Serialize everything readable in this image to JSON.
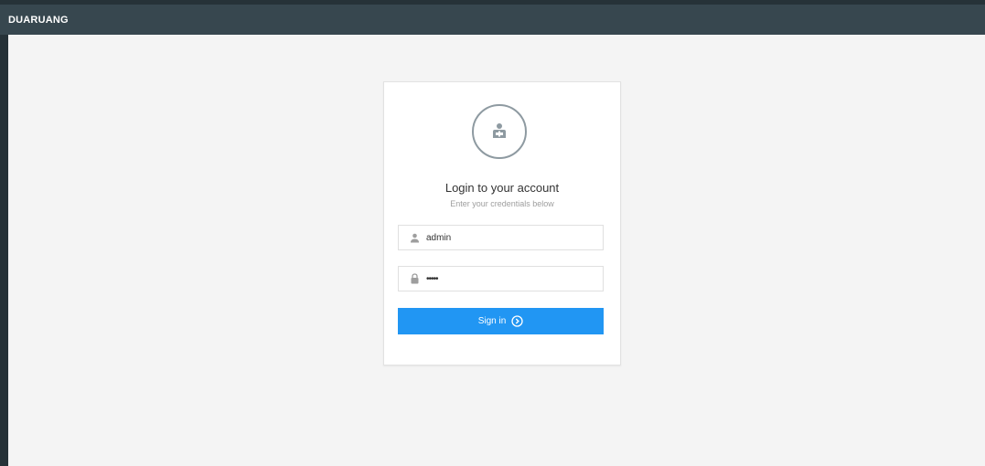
{
  "app": {
    "brand": "DUARUANG"
  },
  "login": {
    "title": "Login to your account",
    "subtitle": "Enter your credentials below",
    "username": {
      "value": "admin",
      "icon": "user-icon"
    },
    "password": {
      "value": "•••••",
      "icon": "lock-icon"
    },
    "submit_label": "Sign in",
    "submit_icon": "circle-arrow-right-icon",
    "avatar_icon": "user-reading-icon"
  },
  "colors": {
    "topbar": "#37474f",
    "primary": "#2196f3",
    "background": "#f4f4f4"
  }
}
